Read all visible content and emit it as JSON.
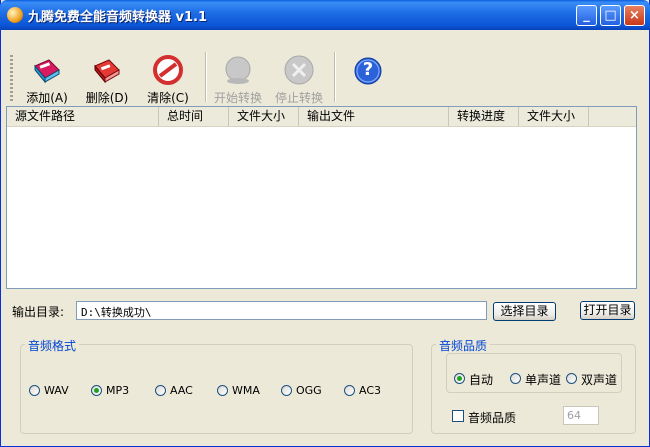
{
  "window": {
    "title": "九腾免费全能音频转换器 v1.1",
    "min_label": "_",
    "max_label": "□",
    "close_label": "×"
  },
  "toolbar": {
    "add_label": "添加(A)",
    "delete_label": "删除(D)",
    "clear_label": "清除(C)",
    "start_label": "开始转换",
    "stop_label": "停止转换",
    "help_label": "?"
  },
  "list": {
    "columns": [
      "源文件路径",
      "总时间",
      "文件大小",
      "输出文件",
      "转换进度",
      "文件大小"
    ]
  },
  "output": {
    "label": "输出目录:",
    "path": "D:\\转换成功\\",
    "choose_label": "选择目录",
    "open_label": "打开目录"
  },
  "format": {
    "title": "音频格式",
    "options": [
      "WAV",
      "MP3",
      "AAC",
      "WMA",
      "OGG",
      "AC3"
    ],
    "selected": "MP3"
  },
  "quality": {
    "title": "音频品质",
    "channels": [
      "自动",
      "单声道",
      "双声道"
    ],
    "selected_channel": "自动",
    "checkbox_label": "音频品质",
    "bitrate": "64"
  },
  "colors": {
    "titlebar": "#0b55d6",
    "group_title": "#0046d5",
    "radio_dot": "#21a121",
    "disabled_text": "#a0a0a0"
  }
}
